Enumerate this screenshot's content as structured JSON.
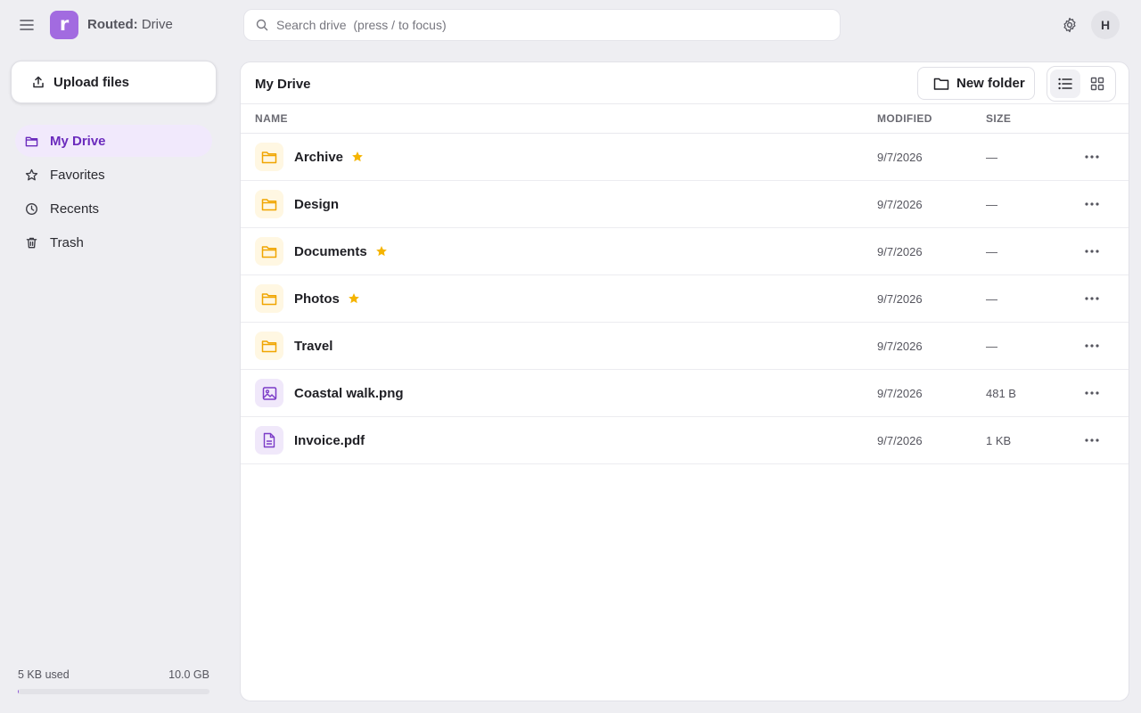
{
  "header": {
    "brand_bold": "Routed:",
    "brand_rest": " Drive",
    "logo_letter": "r",
    "search_placeholder": "Search drive  (press / to focus)",
    "avatar_initial": "H"
  },
  "sidebar": {
    "upload_label": "Upload files",
    "items": [
      {
        "label": "My Drive",
        "icon": "folder-icon",
        "active": true
      },
      {
        "label": "Favorites",
        "icon": "star-icon",
        "active": false
      },
      {
        "label": "Recents",
        "icon": "clock-icon",
        "active": false
      },
      {
        "label": "Trash",
        "icon": "trash-icon",
        "active": false
      }
    ],
    "storage": {
      "used": "5 KB used",
      "total": "10.0 GB",
      "fraction": 5e-06
    }
  },
  "main": {
    "title": "My Drive",
    "new_folder_label": "New folder",
    "view_mode": "list",
    "columns": {
      "name": "NAME",
      "modified": "MODIFIED",
      "size": "SIZE"
    },
    "rows": [
      {
        "name": "Archive",
        "type": "folder",
        "starred": true,
        "modified": "9/7/2026",
        "size": "—"
      },
      {
        "name": "Design",
        "type": "folder",
        "starred": false,
        "modified": "9/7/2026",
        "size": "—"
      },
      {
        "name": "Documents",
        "type": "folder",
        "starred": true,
        "modified": "9/7/2026",
        "size": "—"
      },
      {
        "name": "Photos",
        "type": "folder",
        "starred": true,
        "modified": "9/7/2026",
        "size": "—"
      },
      {
        "name": "Travel",
        "type": "folder",
        "starred": false,
        "modified": "9/7/2026",
        "size": "—"
      },
      {
        "name": "Coastal walk.png",
        "type": "image",
        "starred": false,
        "modified": "9/7/2026",
        "size": "481 B"
      },
      {
        "name": "Invoice.pdf",
        "type": "document",
        "starred": false,
        "modified": "9/7/2026",
        "size": "1 KB"
      }
    ]
  },
  "colors": {
    "accent": "#8e55d8",
    "logo_bg": "#a26be0",
    "active_nav_bg": "#f1e9fc",
    "active_nav_text": "#6b2bbd",
    "folder_icon": "#f0a500",
    "star": "#f5b400",
    "file_icon": "#7b3bc7"
  }
}
